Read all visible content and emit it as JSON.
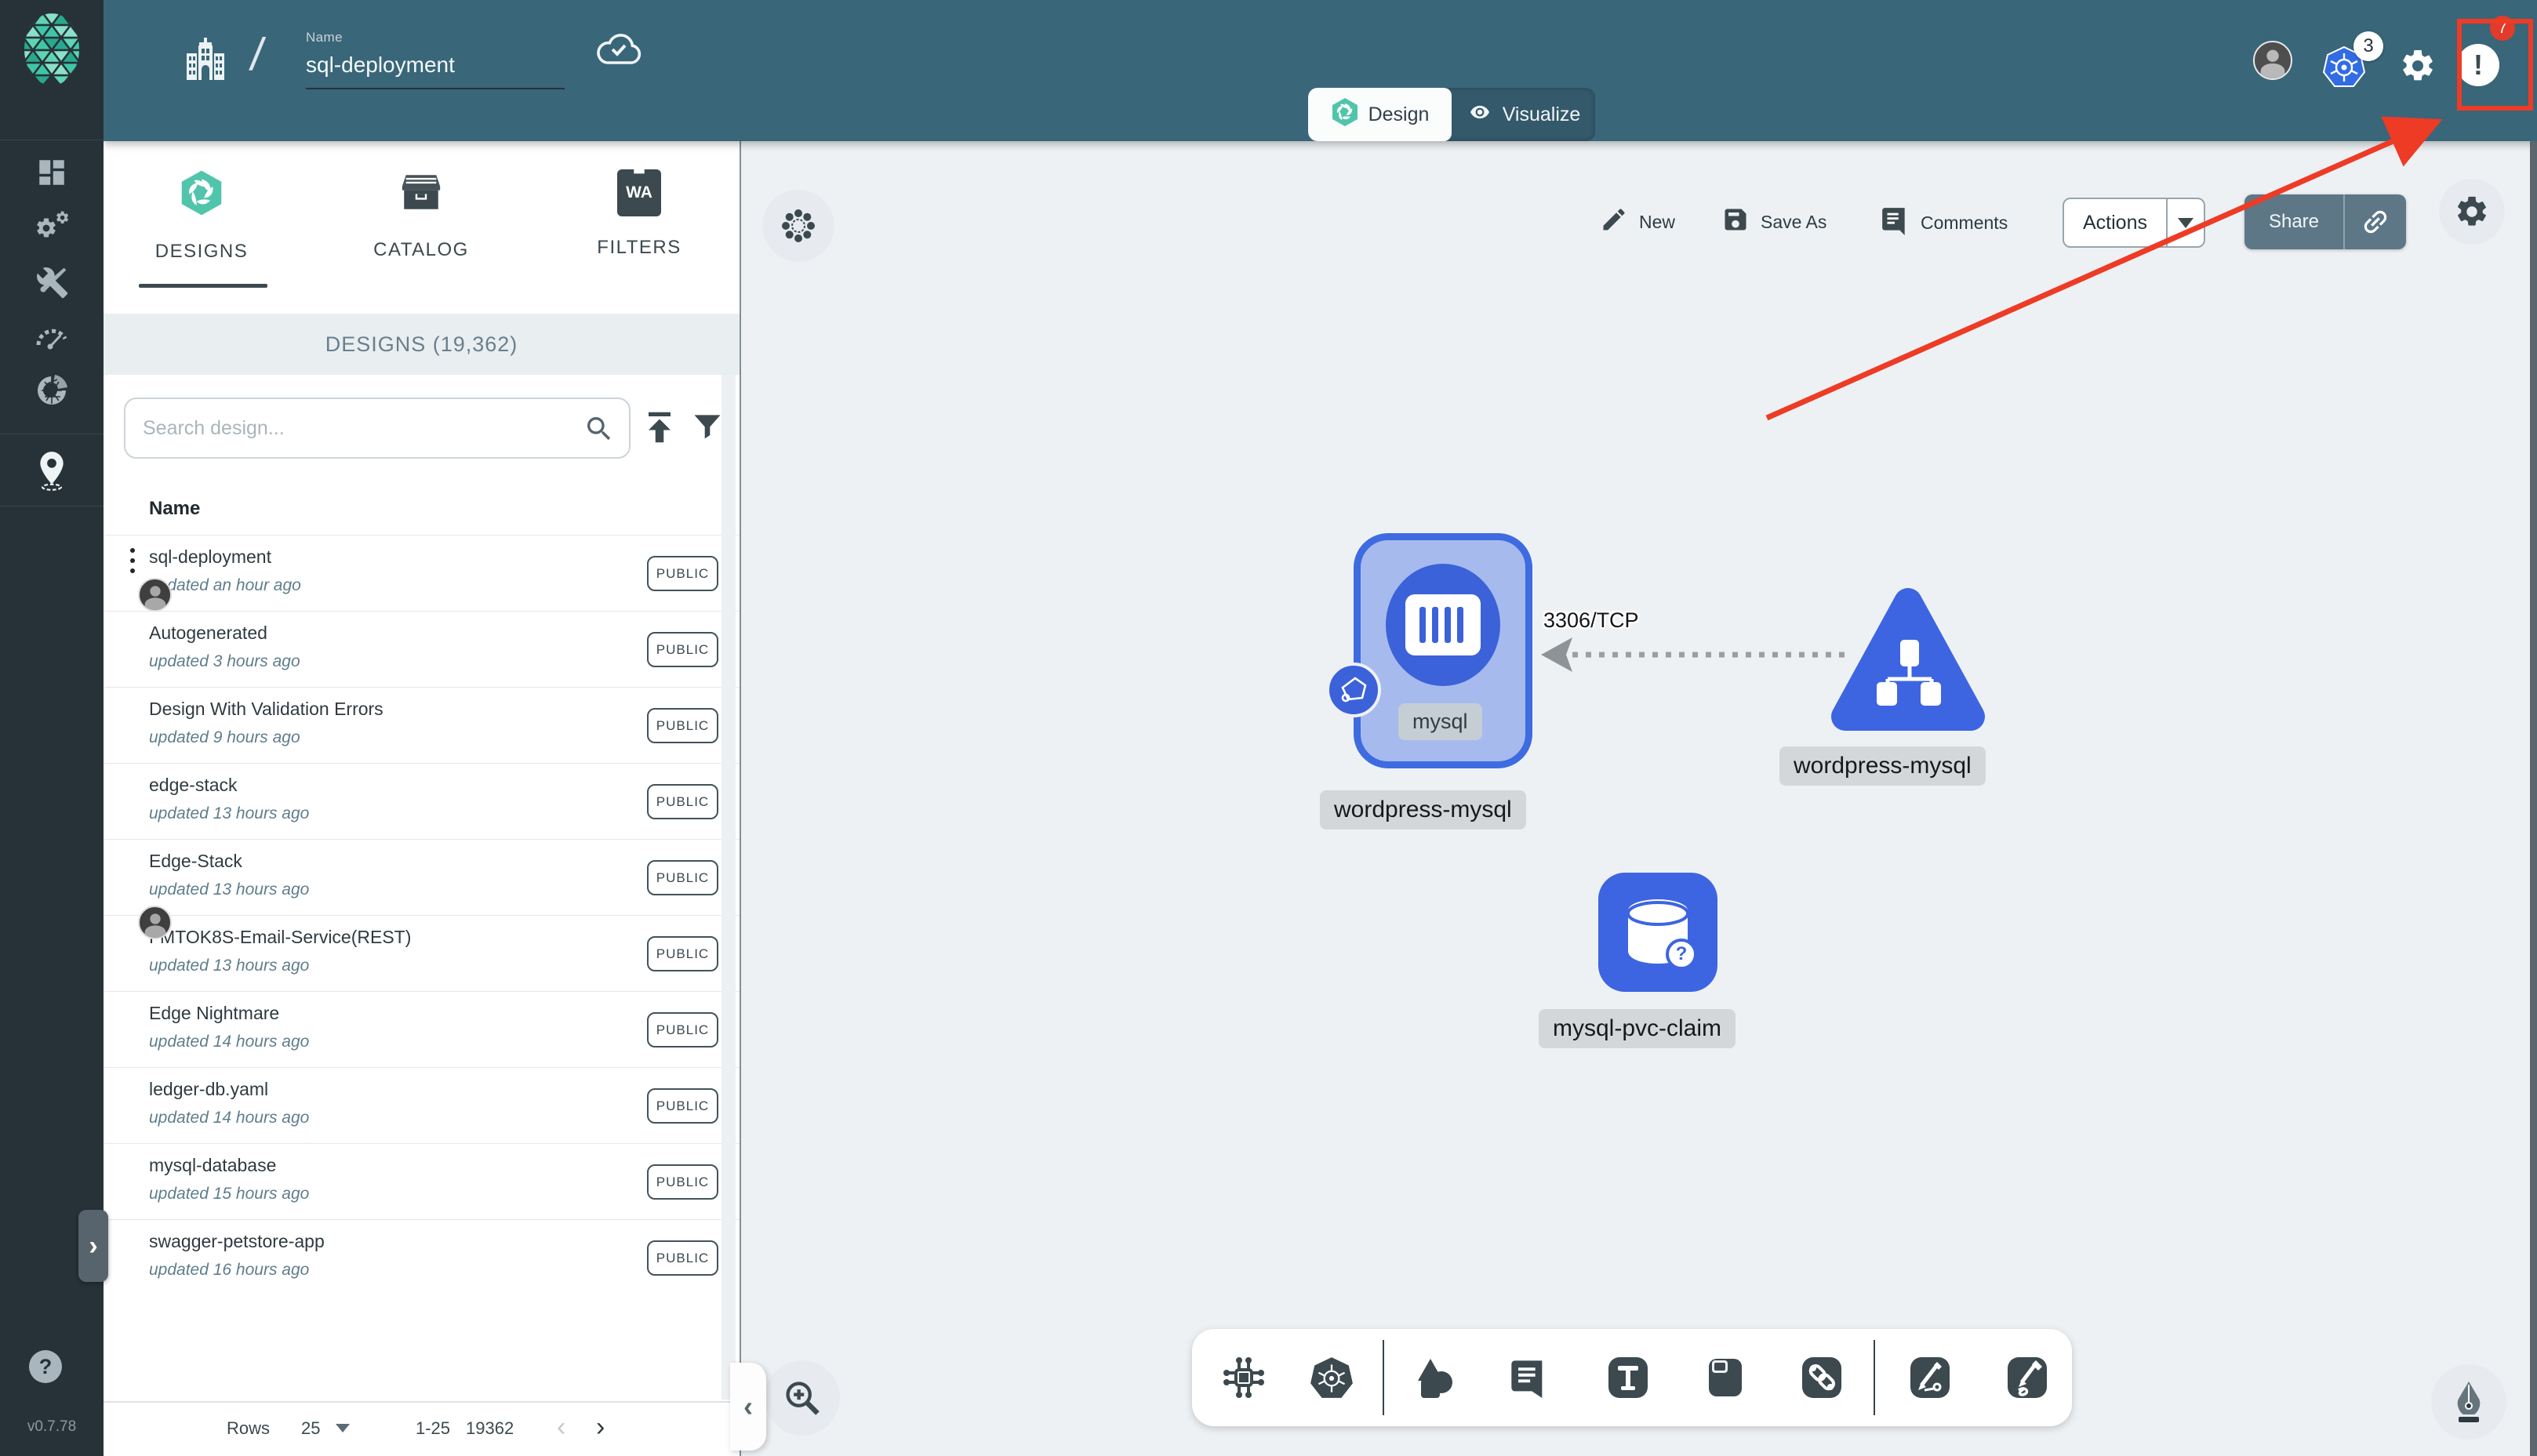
{
  "colors": {
    "accent_green": "#00B39F",
    "header_slate": "#396679",
    "sidebar_dark": "#263238",
    "node_blue": "#3D65E2",
    "kubernetes_blue": "#326CE5",
    "annotation_red": "#EE3B25",
    "badge_red": "#E23B2A",
    "canvas_bg": "#EEF1F4"
  },
  "sidebar": {
    "version": "v0.7.78",
    "help_label": "?",
    "items": [
      "dashboard-icon",
      "lifecycle-gears-icon",
      "configuration-tools-icon",
      "performance-gauge-icon",
      "extensions-icon",
      "kanvas-pin-icon"
    ]
  },
  "header": {
    "name_label": "Name",
    "name_value": "sql-deployment",
    "slash": "/",
    "k8s_context_count": "3",
    "notification_count": "7",
    "notification_glyph": "!",
    "icons": [
      "organization-building-icon",
      "cloud-sync-icon",
      "user-avatar",
      "kubernetes-context-icon",
      "settings-gear-icon",
      "notification-icon"
    ]
  },
  "view_tabs": {
    "design": "Design",
    "visualize": "Visualize"
  },
  "panel": {
    "tabs": [
      {
        "label": "DESIGNS"
      },
      {
        "label": "CATALOG"
      },
      {
        "label": "FILTERS",
        "icon_text": "WA"
      }
    ],
    "section_title": "DESIGNS (19,362)",
    "search_placeholder": "Search design...",
    "column_header": "Name",
    "rows": [
      {
        "name": "sql-deployment",
        "updated": "updated an hour ago",
        "visibility": "PUBLIC",
        "has_menu": true,
        "avatar": "top"
      },
      {
        "name": "Autogenerated",
        "updated": "updated 3 hours ago",
        "visibility": "PUBLIC"
      },
      {
        "name": "Design With Validation Errors",
        "updated": "updated 9 hours ago",
        "visibility": "PUBLIC"
      },
      {
        "name": "edge-stack",
        "updated": "updated 13 hours ago",
        "visibility": "PUBLIC"
      },
      {
        "name": "Edge-Stack",
        "updated": "updated 13 hours ago",
        "visibility": "PUBLIC",
        "avatar": "bottom"
      },
      {
        "name": "FMTOK8S-Email-Service(REST)",
        "updated": "updated 13 hours ago",
        "visibility": "PUBLIC"
      },
      {
        "name": "Edge Nightmare",
        "updated": "updated 14 hours ago",
        "visibility": "PUBLIC"
      },
      {
        "name": "ledger-db.yaml",
        "updated": "updated 14 hours ago",
        "visibility": "PUBLIC"
      },
      {
        "name": "mysql-database",
        "updated": "updated 15 hours ago",
        "visibility": "PUBLIC"
      },
      {
        "name": "swagger-petstore-app",
        "updated": "updated 16 hours ago",
        "visibility": "PUBLIC"
      }
    ],
    "pagination": {
      "rows_label": "Rows",
      "per_page": "25",
      "range": "1-25",
      "total": "19362",
      "prev_glyph": "‹",
      "next_glyph": "›"
    }
  },
  "canvas": {
    "toolbar": {
      "new": "New",
      "save_as": "Save As",
      "comments": "Comments",
      "actions": "Actions",
      "share": "Share"
    },
    "nodes": {
      "deployment_label": "mysql",
      "deployment_group_label": "wordpress-mysql",
      "service_label": "wordpress-mysql",
      "pvc_label": "mysql-pvc-claim",
      "pvc_question": "?"
    },
    "edge": {
      "label": "3306/TCP"
    },
    "bottom_toolbar_icons": [
      "component-icon",
      "kubernetes-icon",
      "shapes-icon",
      "comment-tool-icon",
      "text-tool-icon",
      "note-tool-icon",
      "link-tool-icon",
      "edge-style-icon",
      "freehand-draw-icon"
    ],
    "corner_icons": [
      "dot-grid-icon",
      "zoom-in-icon",
      "pen-nib-icon"
    ]
  }
}
